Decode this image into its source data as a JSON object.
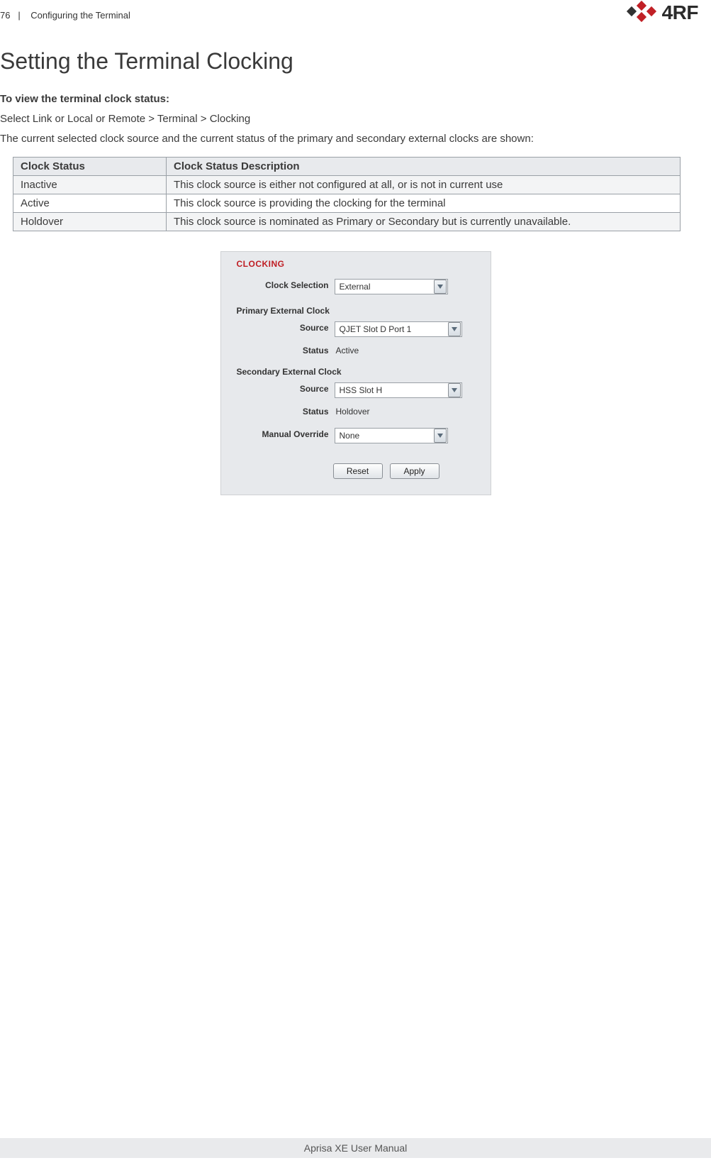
{
  "header": {
    "page_number": "76",
    "section_sep": "|",
    "section_title": "Configuring the Terminal",
    "brand": "4RF"
  },
  "main": {
    "h1": "Setting the Terminal Clocking",
    "subhead": "To view the terminal clock status:",
    "breadcrumb_line": "Select Link or Local or Remote > Terminal > Clocking",
    "intro_line": "The current selected clock source and the current status of the primary and secondary external clocks are shown:"
  },
  "table": {
    "head": {
      "c1": "Clock Status",
      "c2": "Clock Status Description"
    },
    "rows": [
      {
        "c1": "Inactive",
        "c2": "This clock source is either not configured at all, or is not in current use"
      },
      {
        "c1": "Active",
        "c2": "This clock source is providing the clocking for the terminal"
      },
      {
        "c1": "Holdover",
        "c2": "This clock source is nominated as Primary or Secondary but is currently unavailable."
      }
    ]
  },
  "panel": {
    "title": "CLOCKING",
    "clock_selection_label": "Clock Selection",
    "clock_selection_value": "External",
    "primary_section_label": "Primary External Clock",
    "primary_source_label": "Source",
    "primary_source_value": "QJET Slot D Port 1",
    "primary_status_label": "Status",
    "primary_status_value": "Active",
    "secondary_section_label": "Secondary External Clock",
    "secondary_source_label": "Source",
    "secondary_source_value": "HSS Slot H",
    "secondary_status_label": "Status",
    "secondary_status_value": "Holdover",
    "manual_override_label": "Manual Override",
    "manual_override_value": "None",
    "reset_btn": "Reset",
    "apply_btn": "Apply"
  },
  "footer": {
    "text": "Aprisa XE User Manual"
  }
}
